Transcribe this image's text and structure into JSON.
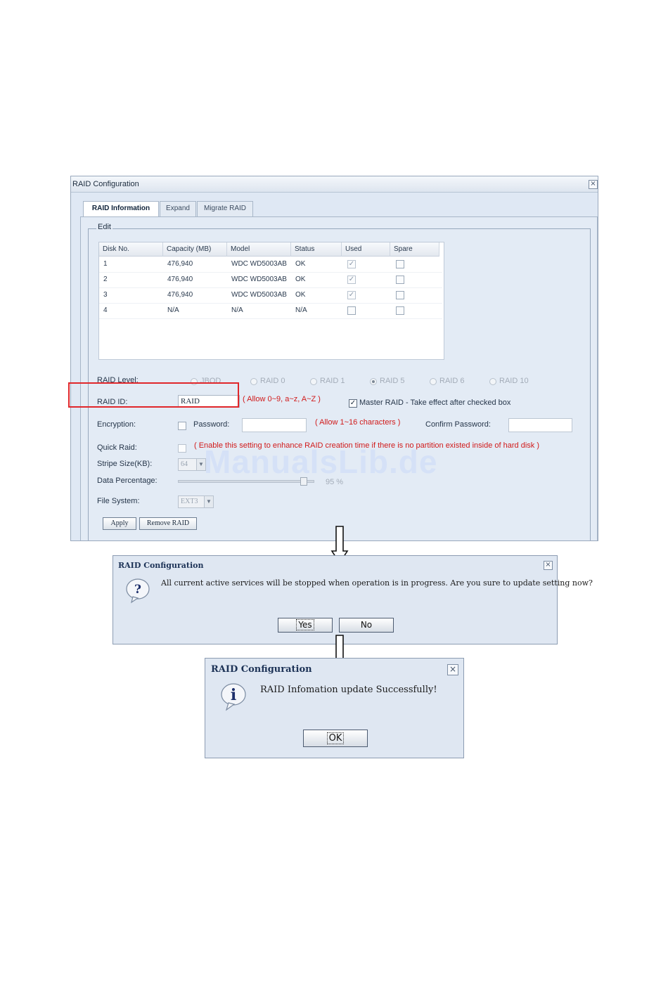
{
  "main_window": {
    "title": "RAID Configuration",
    "tabs": [
      "RAID Information",
      "Expand",
      "Migrate RAID"
    ],
    "edit_legend": "Edit",
    "disk_table": {
      "columns": [
        "Disk No.",
        "Capacity (MB)",
        "Model",
        "Status",
        "Used",
        "Spare"
      ],
      "rows": [
        {
          "disk": "1",
          "capacity": "476,940",
          "model": "WDC WD5003AB",
          "status": "OK",
          "used": true,
          "spare": false
        },
        {
          "disk": "2",
          "capacity": "476,940",
          "model": "WDC WD5003AB",
          "status": "OK",
          "used": true,
          "spare": false
        },
        {
          "disk": "3",
          "capacity": "476,940",
          "model": "WDC WD5003AB",
          "status": "OK",
          "used": true,
          "spare": false
        },
        {
          "disk": "4",
          "capacity": "N/A",
          "model": "N/A",
          "status": "N/A",
          "used": false,
          "spare": false
        }
      ]
    },
    "raid_level": {
      "label": "RAID Level:",
      "options": [
        "JBOD",
        "RAID 0",
        "RAID 1",
        "RAID 5",
        "RAID 6",
        "RAID 10"
      ],
      "selected": "RAID 5"
    },
    "raid_id": {
      "label": "RAID ID:",
      "value": "RAID",
      "hint": "( Allow 0~9, a~z, A~Z )"
    },
    "master_raid": {
      "checked": true,
      "label": "Master RAID - Take effect after checked box"
    },
    "encryption": {
      "label": "Encryption:",
      "password_label": "Password:",
      "password_hint": "( Allow 1~16 characters )",
      "confirm_label": "Confirm Password:"
    },
    "quick_raid": {
      "label": "Quick Raid:",
      "hint": "( Enable this setting to enhance RAID creation time if there is no partition existed inside of hard disk )"
    },
    "stripe_size": {
      "label": "Stripe Size(KB):",
      "value": "64"
    },
    "data_percentage": {
      "label": "Data Percentage:",
      "value_text": "95 %",
      "percent": 95
    },
    "file_system": {
      "label": "File System:",
      "value": "EXT3"
    },
    "buttons": {
      "apply": "Apply",
      "remove": "Remove RAID"
    }
  },
  "watermark": "ManualsLib.de",
  "confirm_dialog": {
    "title": "RAID Configuration",
    "icon": "question-icon",
    "message": "All current active services will be stopped when operation is in progress. Are you sure to update setting now?",
    "yes": "Yes",
    "no": "No"
  },
  "success_dialog": {
    "title": "RAID Configuration",
    "icon": "info-icon",
    "message": "RAID Infomation update Successfully!",
    "ok": "OK"
  },
  "colors": {
    "highlight_box": "#e0262a",
    "hint_text": "#d11a1a"
  }
}
